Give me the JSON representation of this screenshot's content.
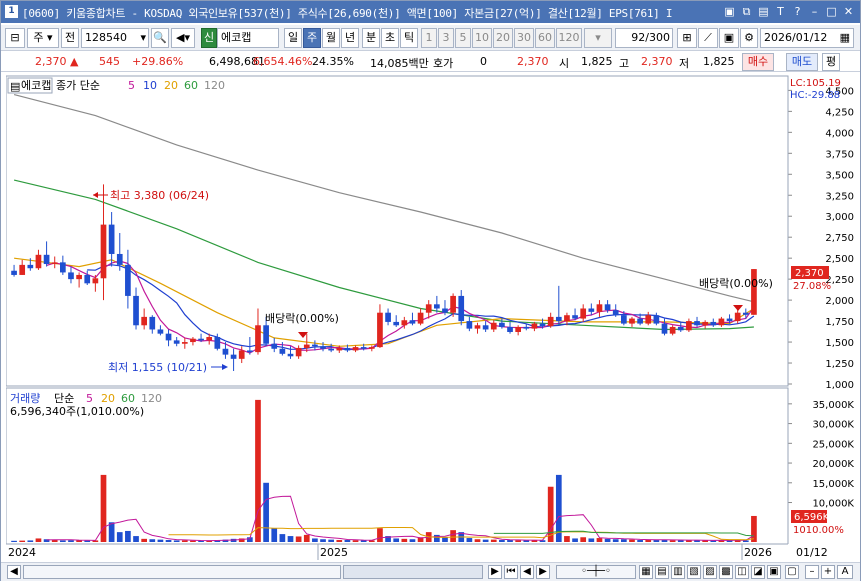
{
  "window": {
    "icon": "1",
    "title": "[0600] 키움종합차트 - KOSDAQ 외국인보유[537(천)] 주식수[26,690(천)] 액면[100] 자본금[27(억)] 결산[12월] EPS[761] I",
    "buttons": [
      "chart-icon",
      "restore-icon",
      "tile-icon",
      "tool-icon",
      "help-icon",
      "minimize-icon",
      "maximize-icon",
      "close-icon"
    ]
  },
  "toolbar": {
    "period_label": "주",
    "all_label": "전",
    "code": "128540",
    "stock_badge": "신",
    "stock_name": "에코캡",
    "timeframes": [
      "일",
      "주",
      "월",
      "년",
      "분",
      "초",
      "틱"
    ],
    "active_timeframe": "주",
    "intervals": [
      "1",
      "3",
      "5",
      "10",
      "20",
      "30",
      "60",
      "120"
    ],
    "count": "92",
    "count_total": "/300",
    "date": "2026/01/12"
  },
  "quote": {
    "price": "2,370",
    "change": "545",
    "change_pct": "+29.86%",
    "volume": "6,498,681",
    "volume_pct": "6,654.46%",
    "turnover": "24.35%",
    "amount": "14,085백만",
    "hoga_label": "호가",
    "hoga_value": "0",
    "hoga_price": "2,370",
    "open_label": "시",
    "open": "1,825",
    "high_label": "고",
    "high": "2,370",
    "low_label": "저",
    "low": "1,825",
    "buy_label": "매수",
    "sell_label": "매도",
    "eval_label": "평"
  },
  "price_panel": {
    "stock_label": "에코캡",
    "legend_title": "종가 단순",
    "ma_labels": [
      "5",
      "10",
      "20",
      "60",
      "120"
    ],
    "ma_colors": [
      "#c2189a",
      "#1f3fd0",
      "#e0a000",
      "#2e9b3e",
      "#8a8a8a"
    ],
    "lc": "LC:105.19",
    "hc": "HC:-29.88",
    "y_ticks": [
      "4,500",
      "4,250",
      "4,000",
      "3,750",
      "3,500",
      "3,250",
      "3,000",
      "2,750",
      "2,500",
      "2,250",
      "2,000",
      "1,750",
      "1,500",
      "1,250",
      "1,000"
    ],
    "y_ticks_values": [
      4500,
      4250,
      4000,
      3750,
      3500,
      3250,
      3000,
      2750,
      2500,
      2250,
      2000,
      1750,
      1500,
      1250,
      1000
    ],
    "current_price_label": "2,370",
    "pct_label": "27.08%",
    "max_annotation": "최고 3,380 (06/24)",
    "min_annotation": "최저 1,155 (10/21)",
    "dividend1": "배당락(0.00%)",
    "dividend2": "배당락(0.00%)"
  },
  "volume_panel": {
    "title": "거래량",
    "legend_title": "단순",
    "ma_labels": [
      "5",
      "20",
      "60",
      "120"
    ],
    "ma_colors": [
      "#c2189a",
      "#e0a000",
      "#2e9b3e",
      "#8a8a8a"
    ],
    "sub_label": "6,596,340주(1,010.00%)",
    "y_ticks": [
      "35,000K",
      "30,000K",
      "25,000K",
      "20,000K",
      "15,000K",
      "10,000K"
    ],
    "y_ticks_values": [
      35000,
      30000,
      25000,
      20000,
      15000,
      10000
    ],
    "current_label": "6,596K",
    "pct_label": "1010.00%"
  },
  "x_axis": {
    "labels": [
      "2024",
      "2025",
      "2026"
    ],
    "end_label": "01/12"
  },
  "chart_data": {
    "type": "candlestick",
    "ylim": [
      1000,
      4600
    ],
    "volume_ylim": [
      0,
      38000
    ],
    "candles": [
      {
        "o": 2350,
        "h": 2420,
        "l": 2280,
        "c": 2300,
        "v": 300
      },
      {
        "o": 2300,
        "h": 2480,
        "l": 2300,
        "c": 2420,
        "v": 350
      },
      {
        "o": 2420,
        "h": 2500,
        "l": 2350,
        "c": 2380,
        "v": 400
      },
      {
        "o": 2380,
        "h": 2600,
        "l": 2360,
        "c": 2540,
        "v": 900
      },
      {
        "o": 2540,
        "h": 2700,
        "l": 2400,
        "c": 2430,
        "v": 700
      },
      {
        "o": 2430,
        "h": 2520,
        "l": 2380,
        "c": 2450,
        "v": 500
      },
      {
        "o": 2450,
        "h": 2530,
        "l": 2300,
        "c": 2330,
        "v": 400
      },
      {
        "o": 2330,
        "h": 2400,
        "l": 2200,
        "c": 2250,
        "v": 450
      },
      {
        "o": 2250,
        "h": 2330,
        "l": 2150,
        "c": 2300,
        "v": 400
      },
      {
        "o": 2300,
        "h": 2350,
        "l": 2180,
        "c": 2200,
        "v": 350
      },
      {
        "o": 2200,
        "h": 2300,
        "l": 2100,
        "c": 2260,
        "v": 400
      },
      {
        "o": 2260,
        "h": 3380,
        "l": 2000,
        "c": 2900,
        "v": 17000
      },
      {
        "o": 2900,
        "h": 3050,
        "l": 2400,
        "c": 2550,
        "v": 5000
      },
      {
        "o": 2550,
        "h": 2800,
        "l": 2350,
        "c": 2420,
        "v": 2500
      },
      {
        "o": 2420,
        "h": 2600,
        "l": 1900,
        "c": 2050,
        "v": 2800
      },
      {
        "o": 2050,
        "h": 2150,
        "l": 1650,
        "c": 1700,
        "v": 1500
      },
      {
        "o": 1700,
        "h": 1900,
        "l": 1650,
        "c": 1800,
        "v": 800
      },
      {
        "o": 1800,
        "h": 1820,
        "l": 1600,
        "c": 1650,
        "v": 700
      },
      {
        "o": 1650,
        "h": 1700,
        "l": 1580,
        "c": 1600,
        "v": 600
      },
      {
        "o": 1600,
        "h": 1650,
        "l": 1450,
        "c": 1520,
        "v": 500
      },
      {
        "o": 1520,
        "h": 1560,
        "l": 1450,
        "c": 1480,
        "v": 400
      },
      {
        "o": 1480,
        "h": 1550,
        "l": 1420,
        "c": 1500,
        "v": 400
      },
      {
        "o": 1500,
        "h": 1560,
        "l": 1460,
        "c": 1540,
        "v": 350
      },
      {
        "o": 1540,
        "h": 1600,
        "l": 1500,
        "c": 1520,
        "v": 300
      },
      {
        "o": 1520,
        "h": 1600,
        "l": 1470,
        "c": 1560,
        "v": 350
      },
      {
        "o": 1560,
        "h": 1600,
        "l": 1400,
        "c": 1420,
        "v": 500
      },
      {
        "o": 1420,
        "h": 1500,
        "l": 1300,
        "c": 1350,
        "v": 600
      },
      {
        "o": 1350,
        "h": 1420,
        "l": 1155,
        "c": 1300,
        "v": 800
      },
      {
        "o": 1300,
        "h": 1450,
        "l": 1250,
        "c": 1400,
        "v": 900
      },
      {
        "o": 1400,
        "h": 1560,
        "l": 1350,
        "c": 1380,
        "v": 1200
      },
      {
        "o": 1380,
        "h": 1900,
        "l": 1350,
        "c": 1700,
        "v": 36000
      },
      {
        "o": 1700,
        "h": 1800,
        "l": 1450,
        "c": 1480,
        "v": 15000
      },
      {
        "o": 1480,
        "h": 1550,
        "l": 1380,
        "c": 1420,
        "v": 3500
      },
      {
        "o": 1420,
        "h": 1500,
        "l": 1340,
        "c": 1360,
        "v": 2000
      },
      {
        "o": 1360,
        "h": 1450,
        "l": 1300,
        "c": 1330,
        "v": 1500
      },
      {
        "o": 1330,
        "h": 1460,
        "l": 1300,
        "c": 1430,
        "v": 1400
      },
      {
        "o": 1430,
        "h": 1600,
        "l": 1380,
        "c": 1470,
        "v": 1800
      },
      {
        "o": 1470,
        "h": 1520,
        "l": 1400,
        "c": 1450,
        "v": 900
      },
      {
        "o": 1450,
        "h": 1500,
        "l": 1390,
        "c": 1420,
        "v": 700
      },
      {
        "o": 1420,
        "h": 1480,
        "l": 1380,
        "c": 1400,
        "v": 600
      },
      {
        "o": 1400,
        "h": 1460,
        "l": 1370,
        "c": 1430,
        "v": 500
      },
      {
        "o": 1430,
        "h": 1470,
        "l": 1380,
        "c": 1400,
        "v": 500
      },
      {
        "o": 1400,
        "h": 1460,
        "l": 1380,
        "c": 1440,
        "v": 450
      },
      {
        "o": 1440,
        "h": 1480,
        "l": 1400,
        "c": 1420,
        "v": 400
      },
      {
        "o": 1420,
        "h": 1460,
        "l": 1390,
        "c": 1440,
        "v": 400
      },
      {
        "o": 1440,
        "h": 1950,
        "l": 1430,
        "c": 1850,
        "v": 3500
      },
      {
        "o": 1850,
        "h": 1900,
        "l": 1700,
        "c": 1740,
        "v": 1500
      },
      {
        "o": 1740,
        "h": 1820,
        "l": 1680,
        "c": 1700,
        "v": 900
      },
      {
        "o": 1700,
        "h": 1800,
        "l": 1660,
        "c": 1760,
        "v": 800
      },
      {
        "o": 1760,
        "h": 1850,
        "l": 1700,
        "c": 1720,
        "v": 700
      },
      {
        "o": 1720,
        "h": 1900,
        "l": 1700,
        "c": 1850,
        "v": 1200
      },
      {
        "o": 1850,
        "h": 2000,
        "l": 1780,
        "c": 1950,
        "v": 2500
      },
      {
        "o": 1950,
        "h": 2050,
        "l": 1850,
        "c": 1900,
        "v": 1800
      },
      {
        "o": 1900,
        "h": 2000,
        "l": 1820,
        "c": 1850,
        "v": 1200
      },
      {
        "o": 1850,
        "h": 2080,
        "l": 1800,
        "c": 2050,
        "v": 3000
      },
      {
        "o": 2050,
        "h": 2120,
        "l": 1700,
        "c": 1750,
        "v": 2500
      },
      {
        "o": 1750,
        "h": 1800,
        "l": 1630,
        "c": 1660,
        "v": 1000
      },
      {
        "o": 1660,
        "h": 1730,
        "l": 1600,
        "c": 1700,
        "v": 700
      },
      {
        "o": 1700,
        "h": 1750,
        "l": 1620,
        "c": 1650,
        "v": 600
      },
      {
        "o": 1650,
        "h": 1760,
        "l": 1620,
        "c": 1730,
        "v": 600
      },
      {
        "o": 1730,
        "h": 1780,
        "l": 1660,
        "c": 1680,
        "v": 500
      },
      {
        "o": 1680,
        "h": 1740,
        "l": 1600,
        "c": 1620,
        "v": 500
      },
      {
        "o": 1620,
        "h": 1700,
        "l": 1580,
        "c": 1680,
        "v": 450
      },
      {
        "o": 1680,
        "h": 1720,
        "l": 1640,
        "c": 1660,
        "v": 400
      },
      {
        "o": 1660,
        "h": 1740,
        "l": 1630,
        "c": 1720,
        "v": 500
      },
      {
        "o": 1720,
        "h": 1780,
        "l": 1660,
        "c": 1690,
        "v": 450
      },
      {
        "o": 1690,
        "h": 1850,
        "l": 1670,
        "c": 1800,
        "v": 14000
      },
      {
        "o": 1800,
        "h": 2170,
        "l": 1700,
        "c": 1750,
        "v": 17000
      },
      {
        "o": 1750,
        "h": 1850,
        "l": 1700,
        "c": 1820,
        "v": 1500
      },
      {
        "o": 1820,
        "h": 1900,
        "l": 1760,
        "c": 1780,
        "v": 900
      },
      {
        "o": 1780,
        "h": 1950,
        "l": 1740,
        "c": 1900,
        "v": 1200
      },
      {
        "o": 1900,
        "h": 1960,
        "l": 1820,
        "c": 1860,
        "v": 900
      },
      {
        "o": 1860,
        "h": 2000,
        "l": 1800,
        "c": 1950,
        "v": 1000
      },
      {
        "o": 1950,
        "h": 2000,
        "l": 1850,
        "c": 1880,
        "v": 800
      },
      {
        "o": 1880,
        "h": 1950,
        "l": 1800,
        "c": 1820,
        "v": 700
      },
      {
        "o": 1820,
        "h": 1870,
        "l": 1700,
        "c": 1720,
        "v": 700
      },
      {
        "o": 1720,
        "h": 1800,
        "l": 1680,
        "c": 1780,
        "v": 600
      },
      {
        "o": 1780,
        "h": 1840,
        "l": 1700,
        "c": 1720,
        "v": 500
      },
      {
        "o": 1720,
        "h": 1860,
        "l": 1700,
        "c": 1820,
        "v": 600
      },
      {
        "o": 1820,
        "h": 1850,
        "l": 1700,
        "c": 1720,
        "v": 500
      },
      {
        "o": 1720,
        "h": 1780,
        "l": 1580,
        "c": 1600,
        "v": 600
      },
      {
        "o": 1600,
        "h": 1700,
        "l": 1580,
        "c": 1680,
        "v": 450
      },
      {
        "o": 1680,
        "h": 1740,
        "l": 1620,
        "c": 1640,
        "v": 400
      },
      {
        "o": 1640,
        "h": 1780,
        "l": 1620,
        "c": 1750,
        "v": 500
      },
      {
        "o": 1750,
        "h": 1800,
        "l": 1680,
        "c": 1700,
        "v": 400
      },
      {
        "o": 1700,
        "h": 1760,
        "l": 1660,
        "c": 1740,
        "v": 400
      },
      {
        "o": 1740,
        "h": 1780,
        "l": 1680,
        "c": 1700,
        "v": 350
      },
      {
        "o": 1700,
        "h": 1800,
        "l": 1680,
        "c": 1780,
        "v": 450
      },
      {
        "o": 1780,
        "h": 1830,
        "l": 1720,
        "c": 1750,
        "v": 400
      },
      {
        "o": 1750,
        "h": 1880,
        "l": 1720,
        "c": 1850,
        "v": 500
      },
      {
        "o": 1850,
        "h": 1900,
        "l": 1780,
        "c": 1825,
        "v": 400
      },
      {
        "o": 1825,
        "h": 2370,
        "l": 1825,
        "c": 2370,
        "v": 6596
      }
    ],
    "ma120": [
      [
        0,
        4450
      ],
      [
        10,
        4200
      ],
      [
        20,
        3850
      ],
      [
        30,
        3550
      ],
      [
        40,
        3280
      ],
      [
        50,
        3050
      ],
      [
        60,
        2800
      ],
      [
        70,
        2500
      ],
      [
        80,
        2250
      ],
      [
        88,
        2050
      ],
      [
        91,
        1980
      ]
    ],
    "ma60": [
      [
        0,
        3430
      ],
      [
        10,
        3200
      ],
      [
        20,
        2850
      ],
      [
        30,
        2450
      ],
      [
        40,
        2150
      ],
      [
        50,
        1900
      ],
      [
        60,
        1750
      ],
      [
        70,
        1700
      ],
      [
        80,
        1650
      ],
      [
        88,
        1660
      ],
      [
        91,
        1680
      ]
    ],
    "ma20": [
      [
        0,
        2500
      ],
      [
        8,
        2400
      ],
      [
        12,
        2480
      ],
      [
        18,
        2200
      ],
      [
        25,
        1850
      ],
      [
        32,
        1550
      ],
      [
        40,
        1450
      ],
      [
        46,
        1480
      ],
      [
        52,
        1700
      ],
      [
        60,
        1780
      ],
      [
        70,
        1740
      ],
      [
        80,
        1740
      ],
      [
        88,
        1720
      ],
      [
        91,
        1900
      ]
    ]
  }
}
